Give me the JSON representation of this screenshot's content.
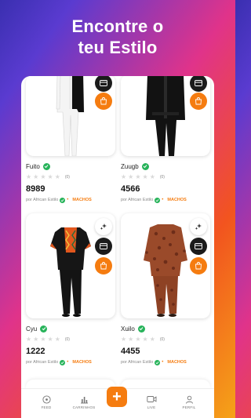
{
  "hero": {
    "line1": "Encontre o",
    "line2": "teu Estilo"
  },
  "products": [
    {
      "name": "Fuito",
      "rating_count": "(0)",
      "price": "8989",
      "seller": "por African Estilo",
      "category": "MACHOS"
    },
    {
      "name": "Zuugb",
      "rating_count": "(0)",
      "price": "4566",
      "seller": "por African Estilo",
      "category": "MACHOS"
    },
    {
      "name": "Cyu",
      "rating_count": "(0)",
      "price": "1222",
      "seller": "por African Estilo",
      "category": "MACHOS"
    },
    {
      "name": "Xuilo",
      "rating_count": "(0)",
      "price": "4455",
      "seller": "por African Estilo",
      "category": "MACHOS"
    }
  ],
  "tabbar": {
    "feed": "FEED",
    "carts": "CARRINHOS",
    "add": "+",
    "live": "LIVE",
    "profile": "PERFIL"
  },
  "colors": {
    "accent": "#f57c10",
    "verified": "#27b35a",
    "icon_dark": "#1b1b1b"
  },
  "icons": [
    "card-icon",
    "cart-icon",
    "sparkle-icon",
    "verified-icon",
    "star-icon",
    "feed-icon",
    "chart-icon",
    "video-icon",
    "user-icon",
    "plus-icon"
  ]
}
